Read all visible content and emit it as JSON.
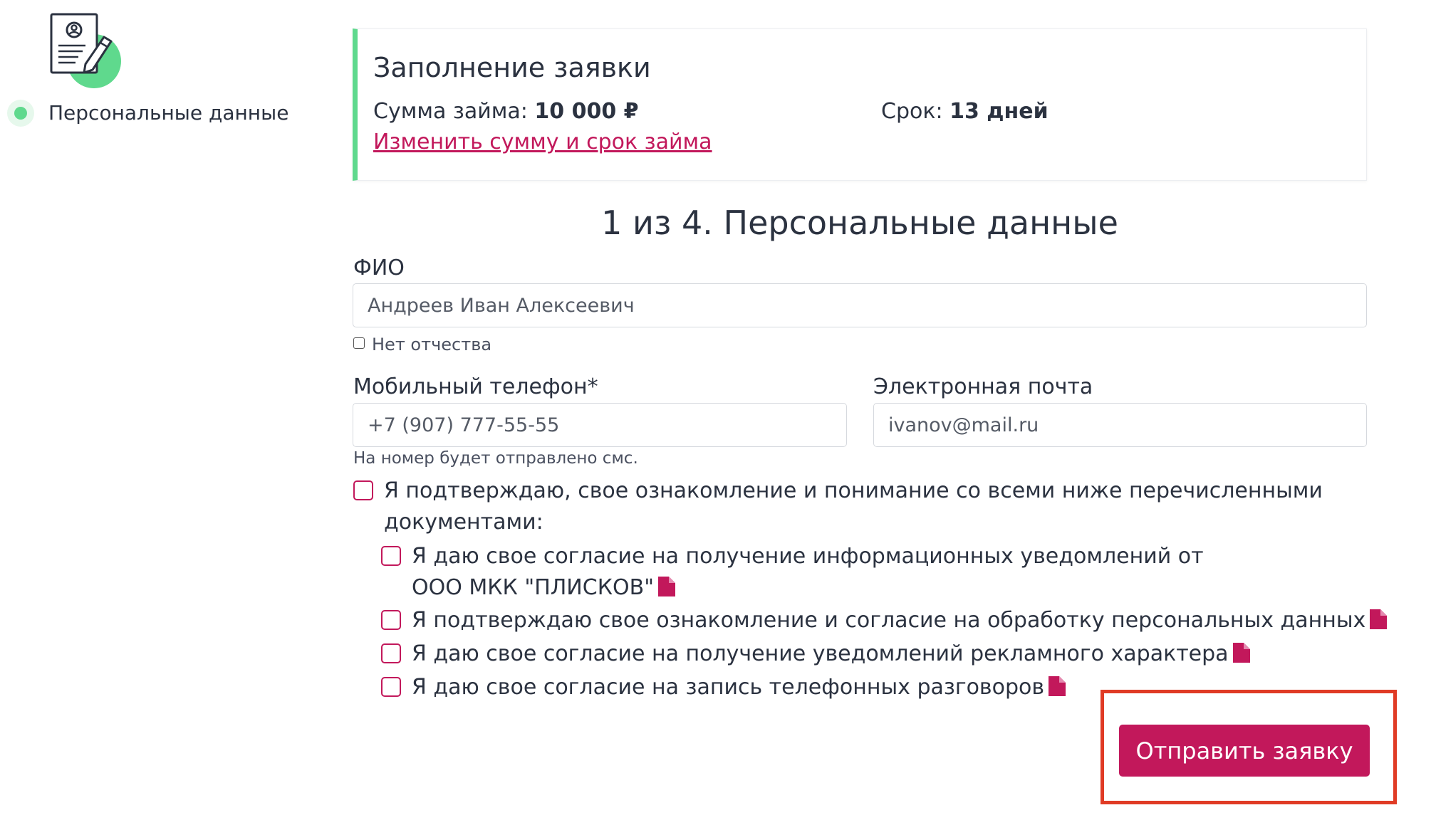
{
  "sidebar": {
    "illustration_icon": "personal-data-document-icon",
    "step_label": "Персональные данные",
    "accent_color": "#5fd98d"
  },
  "summary": {
    "title": "Заполнение заявки",
    "amount_label": "Сумма займа: ",
    "amount_value": "10 000 ₽",
    "term_label": "Срок: ",
    "term_value": "13 дней",
    "change_link": "Изменить сумму и срок займа"
  },
  "form": {
    "step_heading": "1 из 4. Персональные данные",
    "fio": {
      "label": "ФИО",
      "value": "Андреев Иван Алексеевич"
    },
    "no_patronymic_label": "Нет отчества",
    "no_patronymic_checked": false,
    "phone": {
      "label": "Мобильный телефон*",
      "value": "+7 (907) 777-55-55",
      "hint": "На номер будет отправлено смс."
    },
    "email": {
      "label": "Электронная почта",
      "value": "ivanov@mail.ru"
    },
    "consents": {
      "main": "Я подтверждаю, свое ознакомление и понимание со всеми ниже перечисленными документами:",
      "items": [
        {
          "text": "Я даю свое согласие на получение информационных уведомлений от ООО МКК \"ПЛИСКОВ\"",
          "icon": "document-icon"
        },
        {
          "text": "Я подтверждаю свое ознакомление и согласие на обработку персональных данных",
          "icon": "document-icon"
        },
        {
          "text": "Я даю свое согласие на получение уведомлений рекламного характера",
          "icon": "document-icon"
        },
        {
          "text": "Я даю свое согласие на запись телефонных разговоров",
          "icon": "document-icon"
        }
      ]
    },
    "submit_label": "Отправить заявку"
  },
  "colors": {
    "brand": "#c2185b",
    "accent_green": "#5fd98d",
    "highlight": "#e03b25",
    "text": "#2b3240"
  }
}
